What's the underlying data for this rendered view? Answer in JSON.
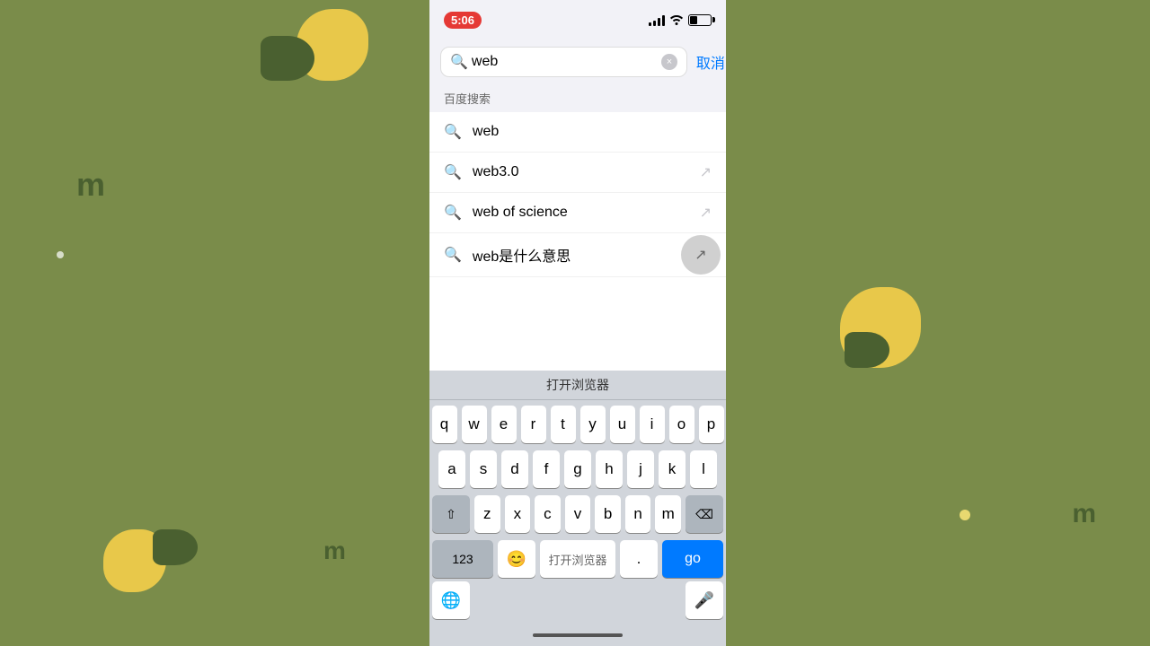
{
  "background": {
    "color": "#7a8c4a"
  },
  "status_bar": {
    "time": "5:06",
    "battery_level": "35%"
  },
  "search": {
    "input_value": "web",
    "clear_label": "×",
    "cancel_label": "取消",
    "placeholder": ""
  },
  "suggestions_header": "百度搜索",
  "suggestions": [
    {
      "text": "web",
      "has_arrow": false
    },
    {
      "text": "web3.0",
      "has_arrow": true
    },
    {
      "text": "web of science",
      "has_arrow": true
    },
    {
      "text": "web是什么意思",
      "has_arrow": false,
      "has_circle": true
    }
  ],
  "keyboard_suggestion": "打开浏览器",
  "keyboard": {
    "row1": [
      "q",
      "w",
      "e",
      "r",
      "t",
      "y",
      "u",
      "i",
      "o",
      "p"
    ],
    "row2": [
      "a",
      "s",
      "d",
      "f",
      "g",
      "h",
      "j",
      "k",
      "l"
    ],
    "row3": [
      "z",
      "x",
      "c",
      "v",
      "b",
      "n",
      "m"
    ],
    "bottom": {
      "numbers_label": "123",
      "space_label": " ",
      "period_label": ".",
      "go_label": "go"
    }
  }
}
